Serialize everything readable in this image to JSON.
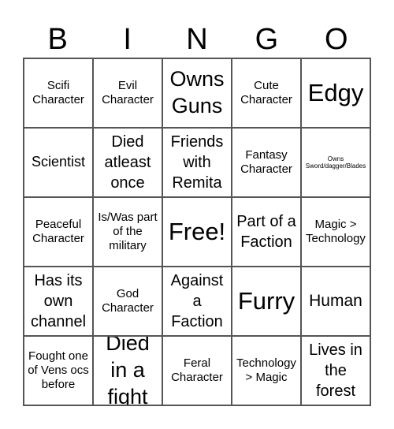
{
  "header": {
    "letters": [
      "B",
      "I",
      "N",
      "G",
      "O"
    ]
  },
  "cells": [
    {
      "text": "Scifi Character",
      "size": "sm"
    },
    {
      "text": "Evil Character",
      "size": "sm"
    },
    {
      "text": "Owns Guns",
      "size": "lg"
    },
    {
      "text": "Cute Character",
      "size": "sm"
    },
    {
      "text": "Edgy",
      "size": "xl"
    },
    {
      "text": "Scientist",
      "size": "md-s"
    },
    {
      "text": "Died atleast once",
      "size": "md"
    },
    {
      "text": "Friends with Remita",
      "size": "md"
    },
    {
      "text": "Fantasy Character",
      "size": "sm"
    },
    {
      "text": "Owns Sword/dagger/Blades",
      "size": "xs"
    },
    {
      "text": "Peaceful Character",
      "size": "sm"
    },
    {
      "text": "Is/Was part of the military",
      "size": "sm"
    },
    {
      "text": "Free!",
      "size": "xl"
    },
    {
      "text": "Part of a Faction",
      "size": "md"
    },
    {
      "text": "Magic > Technology",
      "size": "sm"
    },
    {
      "text": "Has its own channel",
      "size": "md"
    },
    {
      "text": "God Character",
      "size": "sm"
    },
    {
      "text": "Against a Faction",
      "size": "md"
    },
    {
      "text": "Furry",
      "size": "xl"
    },
    {
      "text": "Human",
      "size": "md-s"
    },
    {
      "text": "Fought one of Vens ocs before",
      "size": "sm"
    },
    {
      "text": "Died in a fight",
      "size": "lg"
    },
    {
      "text": "Feral Character",
      "size": "sm"
    },
    {
      "text": "Technology > Magic",
      "size": "sm"
    },
    {
      "text": "Lives in the forest",
      "size": "md"
    }
  ]
}
